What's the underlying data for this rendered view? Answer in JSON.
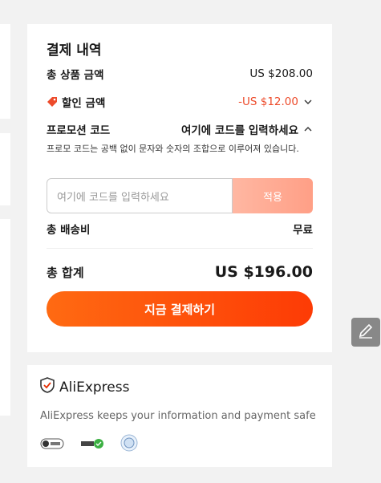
{
  "summary": {
    "title": "결제 내역",
    "subtotal_label": "총 상품 금액",
    "subtotal_value": "US $208.00",
    "discount_label": "할인 금액",
    "discount_value": "-US $12.00",
    "promo_label": "프로모션 코드",
    "promo_toggle": "여기에 코드를 입력하세요",
    "promo_hint": "프로모 코드는 공백 없이 문자와 숫자의 조합으로 이루어져 있습니다.",
    "promo_placeholder": "여기에 코드를 입력하세요",
    "apply_label": "적용",
    "shipping_label": "총 배송비",
    "shipping_value": "무료",
    "total_label": "총 합계",
    "total_value": "US $196.00",
    "pay_label": "지금 결제하기"
  },
  "security": {
    "brand": "AliExpress",
    "text": "AliExpress keeps your information and payment safe"
  },
  "colors": {
    "accent": "#fd3b05",
    "discount": "#ed4b2b"
  },
  "icons": [
    "tag-icon",
    "chevron-down-icon",
    "chevron-up-icon",
    "shield-check-icon",
    "pci-badge-icon",
    "ssl-badge-icon",
    "seal-badge-icon",
    "pencil-icon"
  ]
}
